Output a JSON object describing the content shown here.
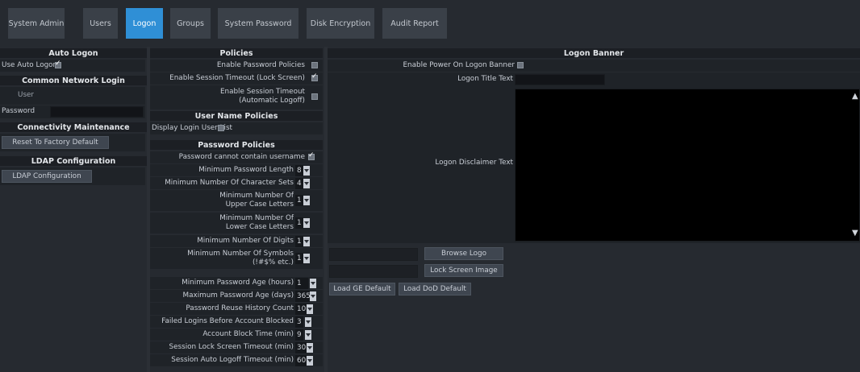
{
  "tabs": [
    {
      "label": "System Admin"
    },
    {
      "label": "Users"
    },
    {
      "label": "Logon"
    },
    {
      "label": "Groups"
    },
    {
      "label": "System Password"
    },
    {
      "label": "Disk Encryption"
    },
    {
      "label": "Audit Report"
    }
  ],
  "active_tab": "Logon",
  "left": {
    "auto_logon_header": "Auto Logon",
    "use_auto_logon_label": "Use Auto Logon",
    "use_auto_logon_checked": true,
    "network_header": "Common Network Login",
    "user_label": "User",
    "user_value": "",
    "password_label": "Password",
    "password_value": "",
    "connectivity_header": "Connectivity Maintenance",
    "reset_button": "Reset To Factory Default",
    "ldap_header": "LDAP Configuration",
    "ldap_button": "LDAP Configuration"
  },
  "middle": {
    "policies_header": "Policies",
    "enable_password_policies": {
      "label": "Enable Password Policies",
      "checked": false
    },
    "enable_session_timeout_lock": {
      "label": "Enable Session Timeout (Lock Screen)",
      "checked": true
    },
    "enable_session_timeout_logoff": {
      "label": "Enable Session Timeout (Automatic Logoff)",
      "checked": false
    },
    "user_name_policies_header": "User Name Policies",
    "display_login_user_list": {
      "label": "Display Login User List",
      "checked": false
    },
    "password_policies_header": "Password Policies",
    "password_cannot_contain_username": {
      "label": "Password cannot contain username",
      "checked": true
    },
    "settings": [
      {
        "label": "Minimum Password Length",
        "value": "8"
      },
      {
        "label": "Minimum Number Of Character Sets",
        "value": "4"
      },
      {
        "label": "Minimum Number Of Upper Case Letters",
        "value": "1"
      },
      {
        "label": "Minimum Number Of Lower Case Letters",
        "value": "1"
      },
      {
        "label": "Minimum Number Of Digits",
        "value": "1"
      },
      {
        "label": "Minimum Number Of Symbols (!#$% etc.)",
        "value": "1"
      },
      {
        "label": "Minimum Password Age (hours)",
        "value": "1"
      },
      {
        "label": "Maximum Password Age (days)",
        "value": "365"
      },
      {
        "label": "Password Reuse History Count",
        "value": "10"
      },
      {
        "label": "Failed Logins Before Account Blocked",
        "value": "3"
      },
      {
        "label": "Account Block Time (min)",
        "value": "9"
      },
      {
        "label": "Session Lock Screen Timeout (min)",
        "value": "30"
      },
      {
        "label": "Session Auto Logoff Timeout (min)",
        "value": "60"
      }
    ]
  },
  "right": {
    "header": "Logon Banner",
    "enable_power_on_banner": {
      "label": "Enable Power On Logon Banner",
      "checked": false
    },
    "logon_title_label": "Logon Title Text",
    "logon_title_value": "",
    "disclaimer_label": "Logon Disclaimer Text",
    "disclaimer_value": "",
    "browse_logo_button": "Browse Logo",
    "lock_screen_image_button": "Lock Screen Image",
    "load_ge_default_button": "Load GE Default",
    "load_dod_default_button": "Load DoD Default"
  },
  "colors": {
    "background": "#2b2f35",
    "panel": "#262a30",
    "header": "#1c1f24",
    "active_tab": "#2f8fd6",
    "tab": "#3a4048"
  }
}
